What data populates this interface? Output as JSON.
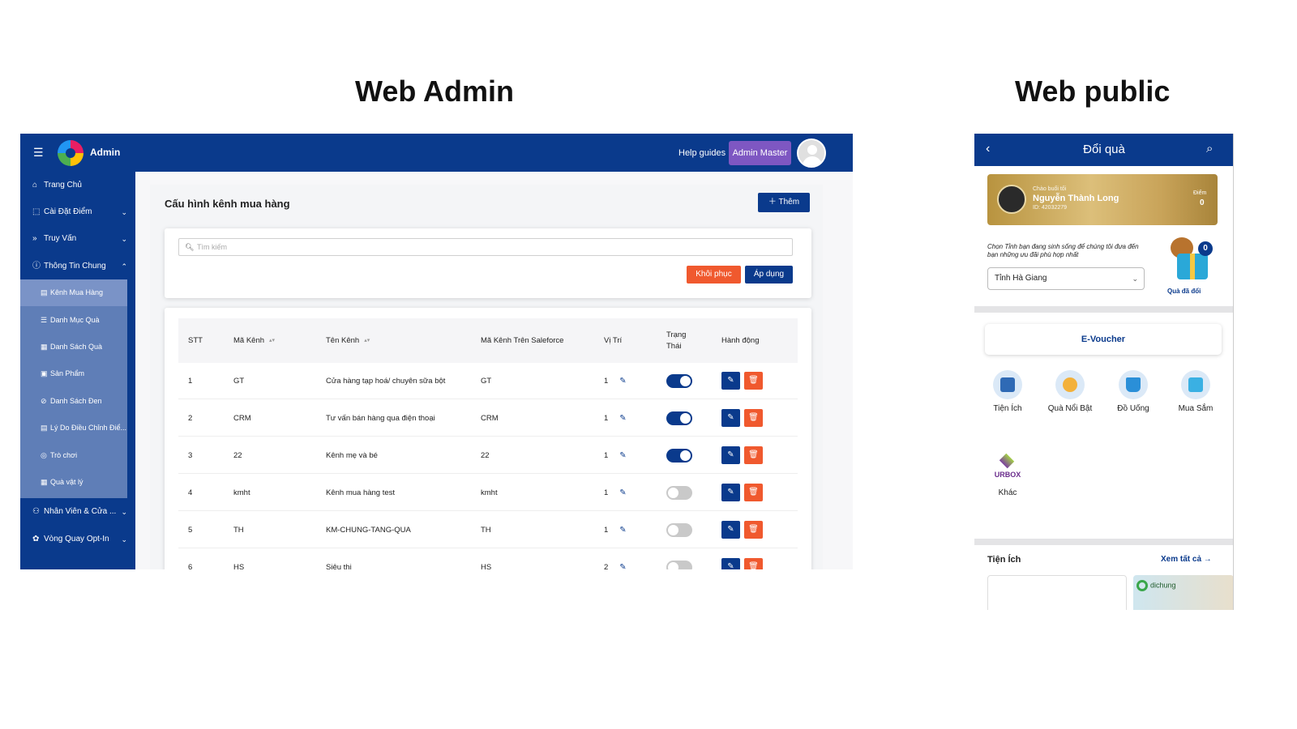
{
  "titles": {
    "admin": "Web Admin",
    "public": "Web public"
  },
  "admin": {
    "header": {
      "brand": "Admin",
      "help": "Help guides",
      "user": "Admin Master"
    },
    "sidebar": {
      "items": [
        {
          "label": "Trang Chủ",
          "icon": "home-icon"
        },
        {
          "label": "Cài Đặt Điểm",
          "icon": "crop-icon"
        },
        {
          "label": "Truy Vấn",
          "icon": "double-chevron-icon"
        },
        {
          "label": "Thông Tin Chung",
          "icon": "info-icon"
        }
      ],
      "submenu": [
        {
          "label": "Kênh Mua Hàng",
          "icon": "shop-icon"
        },
        {
          "label": "Danh Mục Quà",
          "icon": "list-icon"
        },
        {
          "label": "Danh Sách Quà",
          "icon": "gift-icon"
        },
        {
          "label": "Sản Phẩm",
          "icon": "product-icon"
        },
        {
          "label": "Danh Sách Đen",
          "icon": "block-icon"
        },
        {
          "label": "Lý Do Điều Chỉnh Điể...",
          "icon": "reason-icon"
        },
        {
          "label": "Trò chơi",
          "icon": "game-icon"
        },
        {
          "label": "Quà vật lý",
          "icon": "gift-icon"
        }
      ],
      "bottom": [
        {
          "label": "Nhân Viên & Cửa ...",
          "icon": "people-icon"
        },
        {
          "label": "Vòng Quay Opt-In",
          "icon": "wheel-icon"
        }
      ]
    },
    "page": {
      "title": "Cấu hình kênh mua hàng",
      "add_label": "Thêm",
      "search_placeholder": "Tìm kiếm",
      "reset_label": "Khôi phục",
      "apply_label": "Áp dụng"
    },
    "table": {
      "headers": {
        "stt": "STT",
        "code": "Mã Kênh",
        "name": "Tên Kênh",
        "sf": "Mã Kênh Trên Saleforce",
        "pos": "Vị Trí",
        "status": "Trạng Thái",
        "action": "Hành động"
      },
      "rows": [
        {
          "stt": "1",
          "code": "GT",
          "name": "Cửa hàng tạp hoá/ chuyên sữa bột",
          "sf": "GT",
          "pos": "1",
          "on": true
        },
        {
          "stt": "2",
          "code": "CRM",
          "name": "Tư vấn bán hàng qua điện thoại",
          "sf": "CRM",
          "pos": "1",
          "on": true
        },
        {
          "stt": "3",
          "code": "22",
          "name": "Kênh mẹ và bé",
          "sf": "22",
          "pos": "1",
          "on": true
        },
        {
          "stt": "4",
          "code": "kmht",
          "name": "Kênh mua hàng test",
          "sf": "kmht",
          "pos": "1",
          "on": false
        },
        {
          "stt": "5",
          "code": "TH",
          "name": "KM-CHUNG-TANG-QUA",
          "sf": "TH",
          "pos": "1",
          "on": false
        },
        {
          "stt": "6",
          "code": "HS",
          "name": "Siêu thị",
          "sf": "HS",
          "pos": "2",
          "on": false
        }
      ]
    }
  },
  "public": {
    "header": {
      "title": "Đổi quà"
    },
    "card": {
      "greeting": "Chào buổi tối",
      "name": "Nguyễn Thành Long",
      "id": "ID: 42032279",
      "points_label": "Điểm",
      "points": "0"
    },
    "province": {
      "prompt": "Chọn Tỉnh bạn đang sinh sống để chúng tôi đưa đến bạn những ưu đãi phù hợp nhất",
      "selected": "Tỉnh Hà Giang"
    },
    "redeemed": {
      "count": "0",
      "label": "Quà đã đổi"
    },
    "evoucher": "E-Voucher",
    "categories": [
      {
        "label": "Tiện Ích"
      },
      {
        "label": "Quà Nổi Bật"
      },
      {
        "label": "Đồ Uống"
      },
      {
        "label": "Mua Sắm"
      },
      {
        "label": "Khác",
        "brand": "URBOX"
      }
    ],
    "utilities": {
      "title": "Tiện Ích",
      "see_all": "Xem tất cả",
      "partner": "dichung"
    }
  }
}
